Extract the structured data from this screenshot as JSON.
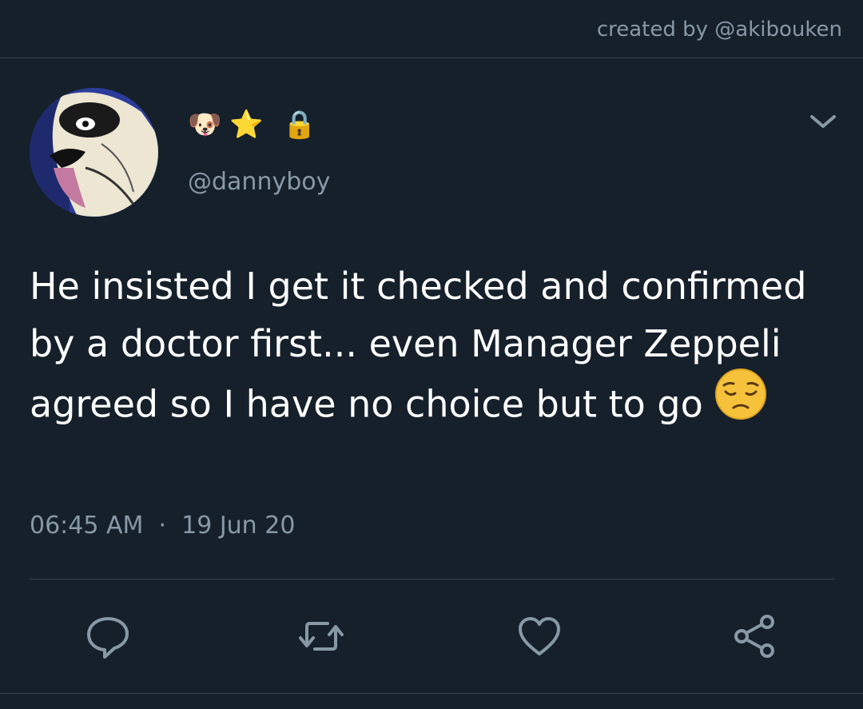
{
  "credit": "created by @akibouken",
  "user": {
    "display_name_icons": [
      "dog-face-icon",
      "star-icon",
      "lock-icon"
    ],
    "display_name_glyphs": [
      "🐶",
      "⭐",
      "🔒"
    ],
    "handle": "@dannyboy"
  },
  "tweet": {
    "text": "He insisted I get it checked and confirmed by a doctor first... even Manager Zeppeli agreed so I have no choice but to go",
    "emoji": "pensive-face-icon",
    "time": "06:45 AM",
    "separator": "·",
    "date": "19 Jun 20"
  },
  "actions": [
    "reply-icon",
    "retweet-icon",
    "like-icon",
    "share-icon"
  ],
  "colors": {
    "background": "#15202b",
    "divider": "#38444d",
    "muted": "#8899a6",
    "text": "#ffffff"
  }
}
